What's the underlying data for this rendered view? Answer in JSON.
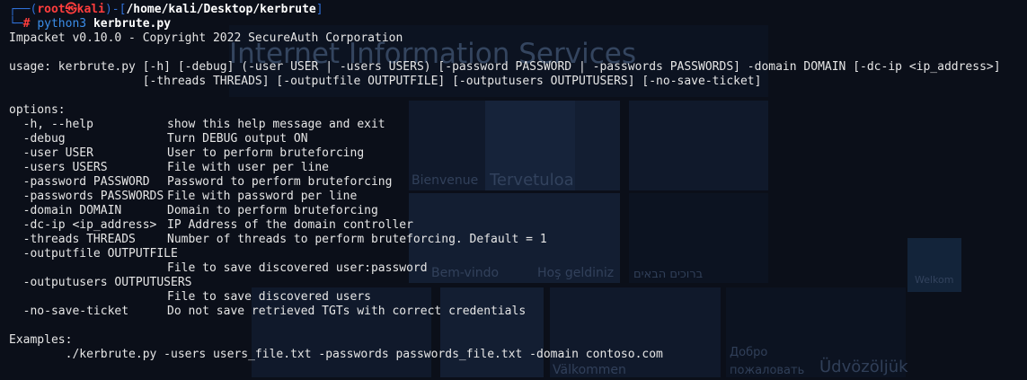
{
  "prompt": {
    "user": "root",
    "host_sep": "㉿",
    "host": "kali",
    "path": "/home/kali/Desktop/kerbrute",
    "hash": "#",
    "command": "python3",
    "arg": "kerbrute.py"
  },
  "output": {
    "banner": "Impacket v0.10.0 - Copyright 2022 SecureAuth Corporation",
    "usage_line1": "usage: kerbrute.py [-h] [-debug] (-user USER | -users USERS) [-password PASSWORD | -passwords PASSWORDS] -domain DOMAIN [-dc-ip <ip_address>]",
    "usage_line2": "                   [-threads THREADS] [-outputfile OUTPUTFILE] [-outputusers OUTPUTUSERS] [-no-save-ticket]",
    "options_header": "options:",
    "options": [
      {
        "flag": "  -h, --help",
        "desc": "show this help message and exit"
      },
      {
        "flag": "  -debug",
        "desc": "Turn DEBUG output ON"
      },
      {
        "flag": "  -user USER",
        "desc": "User to perform bruteforcing"
      },
      {
        "flag": "  -users USERS",
        "desc": "File with user per line"
      },
      {
        "flag": "  -password PASSWORD",
        "desc": "Password to perform bruteforcing"
      },
      {
        "flag": "  -passwords PASSWORDS",
        "desc": "File with password per line"
      },
      {
        "flag": "  -domain DOMAIN",
        "desc": "Domain to perform bruteforcing"
      },
      {
        "flag": "  -dc-ip <ip_address>",
        "desc": "IP Address of the domain controller"
      },
      {
        "flag": "  -threads THREADS",
        "desc": "Number of threads to perform bruteforcing. Default = 1"
      }
    ],
    "outputfile_flag": "  -outputfile OUTPUTFILE",
    "outputfile_desc": "File to save discovered user:password",
    "outputusers_flag": "  -outputusers OUTPUTUSERS",
    "outputusers_desc": "File to save discovered users",
    "nosave_flag": "  -no-save-ticket",
    "nosave_desc": "Do not save retrieved TGTs with correct credentials",
    "examples_header": "Examples:",
    "example": "        ./kerbrute.py -users users_file.txt -passwords passwords_file.txt -domain contoso.com"
  },
  "background": {
    "title": "Internet Information Services",
    "words": [
      "Bienvenue",
      "Tervetuloa",
      "Bem-vindo",
      "Hoş geldiniz",
      "ברוכים הבאים",
      "Добро пожаловать",
      "Üdvözöljük",
      "Välkommen",
      "Welkom"
    ]
  }
}
